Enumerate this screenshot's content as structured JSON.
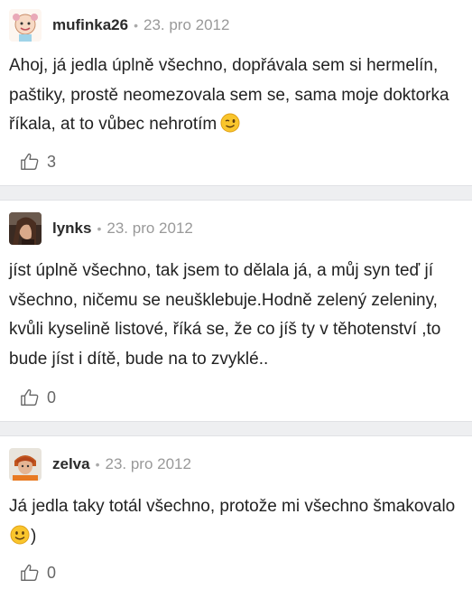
{
  "comments": [
    {
      "username": "mufinka26",
      "separator": "•",
      "date": "23. pro 2012",
      "text": "Ahoj, já jedla úplně všechno, dopřávala sem si hermelín, paštiky, prostě neomezovala sem se, sama moje doktorka říkala, at to vůbec nehrotím",
      "emoji": "wink-emoji",
      "likes": "3",
      "like_icon": "thumbs-up-icon"
    },
    {
      "username": "lynks",
      "separator": "•",
      "date": "23. pro 2012",
      "text": "jíst úplně všechno, tak jsem to dělala já, a můj syn teď jí všechno, ničemu se neušklebuje.Hodně zelený zeleniny, kvůli kyselině listové, říká se, že co jíš ty v těhotenství ,to bude jíst i dítě, bude na to zvyklé..",
      "likes": "0",
      "like_icon": "thumbs-up-icon"
    },
    {
      "username": "zelva",
      "separator": "•",
      "date": "23. pro 2012",
      "text_before_emoji": "Já jedla taky totál všechno, protože mi všechno šmakovalo",
      "emoji": "smile-emoji",
      "text_after_emoji": ")",
      "likes": "0",
      "like_icon": "thumbs-up-icon"
    }
  ]
}
